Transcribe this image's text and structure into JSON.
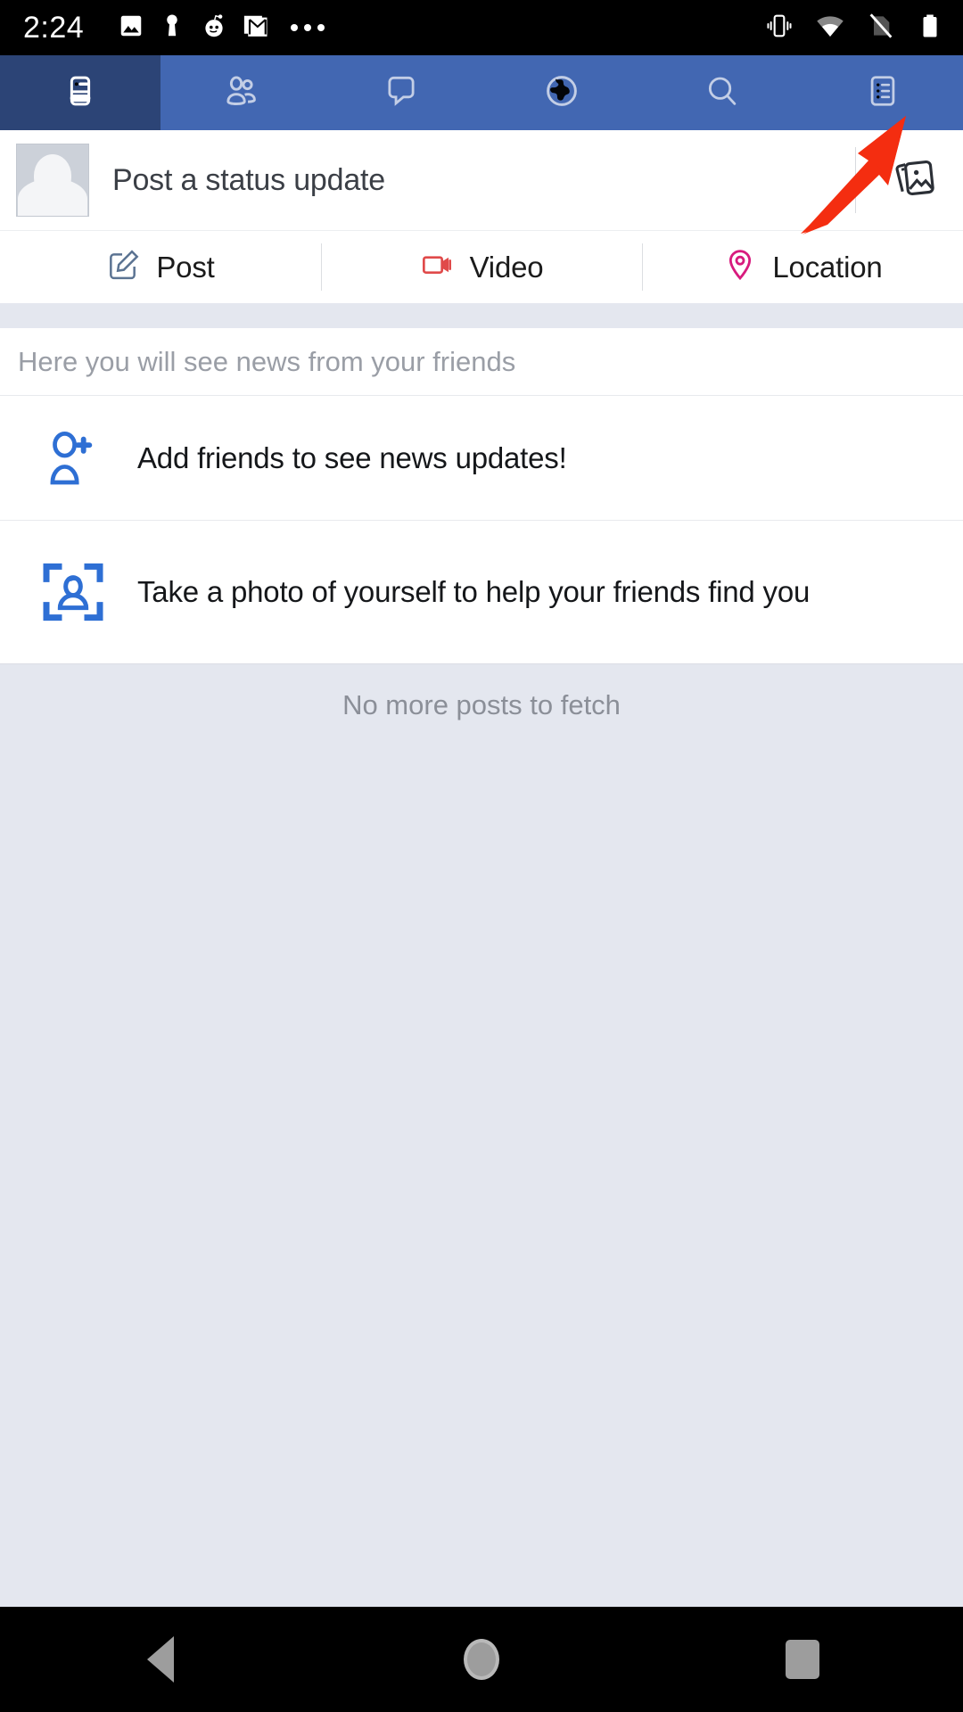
{
  "statusbar": {
    "clock": "2:24",
    "left_icons": [
      {
        "name": "photos-icon",
        "label": "Photos"
      },
      {
        "name": "keyhole-icon",
        "label": "Keyhole"
      },
      {
        "name": "reddit-icon",
        "label": "Reddit"
      },
      {
        "name": "gmail-icon",
        "label": "Gmail"
      },
      {
        "name": "more-notifications-icon",
        "label": "More notifications"
      }
    ],
    "right_icons": [
      {
        "name": "vibrate-icon",
        "label": "Vibrate mode"
      },
      {
        "name": "wifi-icon",
        "label": "Wi-Fi connected"
      },
      {
        "name": "no-sim-icon",
        "label": "No SIM card"
      },
      {
        "name": "battery-icon",
        "label": "Battery full"
      }
    ]
  },
  "topnav": {
    "active_index": 0,
    "active_bg": "#2c4476",
    "bar_bg": "#4267b2",
    "icon_active_color": "#ffffff",
    "icon_color": "#c3cee6",
    "tabs": [
      {
        "name": "tab-news-feed",
        "icon": "news-feed-icon",
        "label": "News Feed"
      },
      {
        "name": "tab-friends",
        "icon": "friends-icon",
        "label": "Friends"
      },
      {
        "name": "tab-messages",
        "icon": "chat-bubble-icon",
        "label": "Messages"
      },
      {
        "name": "tab-notifications",
        "icon": "globe-icon",
        "label": "Notifications"
      },
      {
        "name": "tab-search",
        "icon": "search-icon",
        "label": "Search"
      },
      {
        "name": "tab-menu",
        "icon": "list-menu-icon",
        "label": "Menu"
      }
    ]
  },
  "composer": {
    "placeholder": "Post a status update",
    "avatar_name": "default-avatar",
    "photo_button": "photo-picker-icon"
  },
  "actions": [
    {
      "name": "post-button",
      "label": "Post",
      "icon": "edit-pencil-icon",
      "color": "#5b7392"
    },
    {
      "name": "video-button",
      "label": "Video",
      "icon": "video-camera-icon",
      "color": "#e04a4a"
    },
    {
      "name": "location-button",
      "label": "Location",
      "icon": "location-pin-icon",
      "color": "#d81b7e"
    }
  ],
  "feed": {
    "header": "Here you will see news from your friends",
    "suggestions": [
      {
        "name": "add-friends-row",
        "label": "Add friends to see news updates!",
        "icon": "add-person-icon",
        "color": "#2e6fd4"
      },
      {
        "name": "take-photo-row",
        "label": "Take a photo of yourself to help your friends find you",
        "icon": "face-scan-icon",
        "color": "#2e6fd4"
      }
    ],
    "end_message": "No more posts to fetch"
  },
  "annotation": {
    "name": "red-arrow-pointing-to-menu-tab",
    "color": "#f42d10",
    "points_at": "tab-menu"
  },
  "sysnav": [
    {
      "name": "system-back-button",
      "label": "Back"
    },
    {
      "name": "system-home-button",
      "label": "Home"
    },
    {
      "name": "system-recents-button",
      "label": "Recents"
    }
  ]
}
